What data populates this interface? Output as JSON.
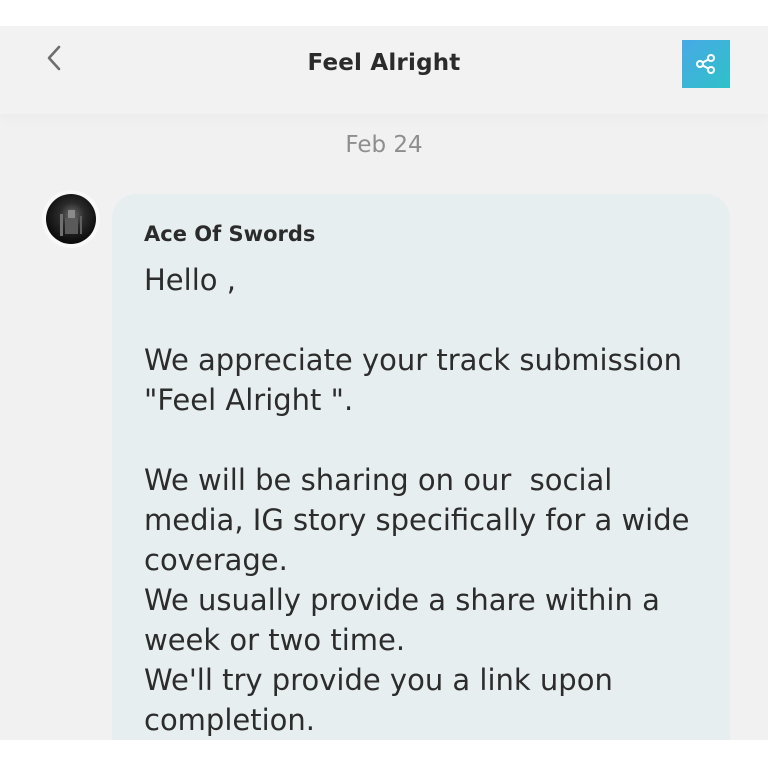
{
  "header": {
    "title": "Feel Alright",
    "back_icon": "chevron-left-icon",
    "share_icon": "share-icon",
    "share_color": "#3fb3d8"
  },
  "conversation": {
    "date": "Feb 24",
    "messages": [
      {
        "sender": "Ace Of Swords",
        "text": "Hello ,\n\nWe appreciate your track submission \"Feel Alright \".\n\nWe will be sharing on our  social media, IG story specifically for a wide coverage.\nWe usually provide a share within a week or two time.\nWe'll try provide you a link upon completion."
      }
    ]
  }
}
